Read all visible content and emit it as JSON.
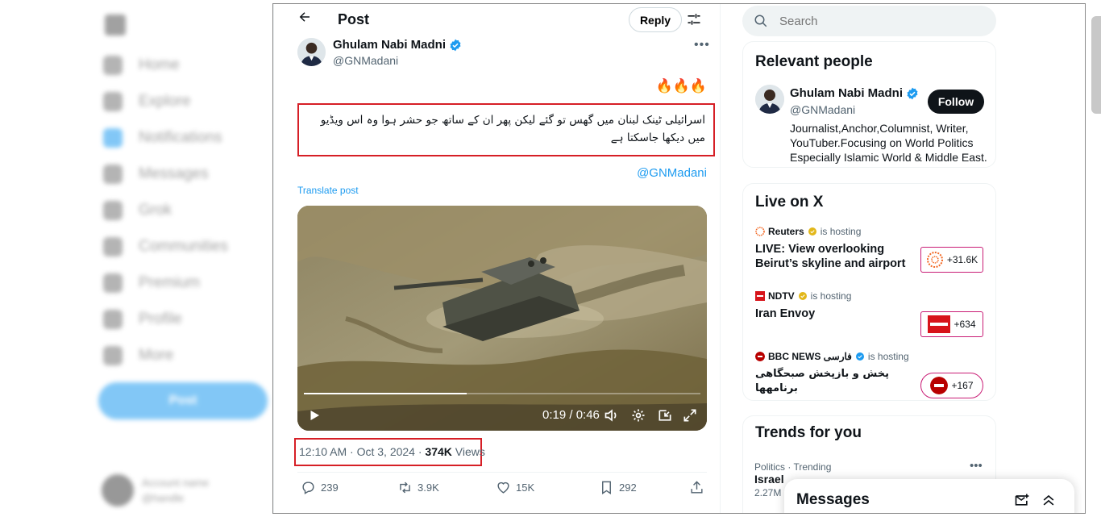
{
  "left_nav": {
    "items": [
      {
        "label": "Home"
      },
      {
        "label": "Explore"
      },
      {
        "label": "Notifications"
      },
      {
        "label": "Messages"
      },
      {
        "label": "Grok"
      },
      {
        "label": "Communities"
      },
      {
        "label": "Premium"
      },
      {
        "label": "Profile"
      },
      {
        "label": "More"
      }
    ],
    "post_label": "Post",
    "account_name": "Account name",
    "account_handle": "@handle"
  },
  "header": {
    "title": "Post",
    "reply_label": "Reply"
  },
  "post": {
    "author_name": "Ghulam Nabi Madni",
    "author_handle": "@GNMadani",
    "emoji": "🔥🔥🔥",
    "text": "اسرائیلی ٹینک لبنان میں گھس تو گئے لیکن پھر ان کے ساتھ جو حشر ہوا وہ اس ویڈیو میں دیکھا جاسکتا ہے",
    "mention": "@GNMadani",
    "translate_label": "Translate post",
    "video": {
      "time_display": "0:19 / 0:46",
      "progress": 0.41
    },
    "timestamp": "12:10 AM · Oct 3, 2024 · ",
    "views_count": "374K",
    "views_label": " Views",
    "replies": "239",
    "reposts": "3.9K",
    "likes": "15K",
    "bookmarks": "292"
  },
  "sidebar": {
    "search_placeholder": "Search",
    "relevant_people": {
      "title": "Relevant people",
      "name": "Ghulam Nabi Madni",
      "handle": "@GNMadani",
      "follow_label": "Follow",
      "bio": "Journalist,Anchor,Columnist, Writer, YouTuber.Focusing on World Politics Especially Islamic World & Middle East."
    },
    "live": {
      "title": "Live on X",
      "hosting_label": "is hosting",
      "items": [
        {
          "host": "Reuters",
          "title": "LIVE: View overlooking Beirut’s skyline and airport",
          "count": "+31.6K"
        },
        {
          "host": "NDTV",
          "title": "Iran Envoy",
          "count": "+634"
        },
        {
          "host": "BBC NEWS فارسی",
          "title": "پخش و بازپخش صبحگاهی برنامهها",
          "count": "+167"
        }
      ]
    },
    "trends": {
      "title": "Trends for you",
      "meta": "Politics · Trending",
      "name": "Israel",
      "count": "2.27M"
    }
  },
  "messages": {
    "title": "Messages"
  },
  "colors": {
    "accent": "#1d9bf0",
    "highlight_box": "#d61f26",
    "live_border": "#c91d76",
    "text_primary": "#0f1419",
    "text_secondary": "#536471"
  }
}
